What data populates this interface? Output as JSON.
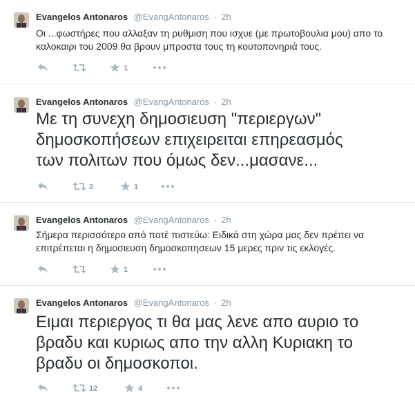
{
  "tweets": [
    {
      "name": "Evangelos Antonaros",
      "handle": "@EvangAntonaros",
      "separator": "·",
      "time": "2h",
      "text": "Οι ...φωστήρες που αλλαξαν τη ρυθμιση που ισχυε (με πρωτοβουλια μου) απο το καλοκαιρι του 2009 θα βρουν μπροστα τους τη κουτοπονηριά τους.",
      "retweets": "",
      "favorites": "1"
    },
    {
      "name": "Evangelos Antonaros",
      "handle": "@EvangAntonaros",
      "separator": "·",
      "time": "2h",
      "text": "Με τη συνεχη δημοσιευση \"περιεργων\" δημοσκοπήσεων επιχειρειται επηρεασμός των πολιτων που όμως δεν...μασανε...",
      "retweets": "2",
      "favorites": "1"
    },
    {
      "name": "Evangelos Antonaros",
      "handle": "@EvangAntonaros",
      "separator": "·",
      "time": "2h",
      "text": "Σήμερα περισσότερο από ποτέ πιστεύω: Ειδικά στη χώρα μας δεν πρέπει να επιτρέπεται η δημοσιευση δημοσκοπησεων 15 μερες πριν τις εκλογές.",
      "retweets": "",
      "favorites": "1"
    },
    {
      "name": "Evangelos Antonaros",
      "handle": "@EvangAntonaros",
      "separator": "·",
      "time": "2h",
      "text": "Ειμαι περιεργος τι θα μας λενε απο αυριο το βραδυ και κυριως απο την αλλη Κυριακη το βραδυ οι δημοσκοποι.",
      "retweets": "12",
      "favorites": "4"
    }
  ],
  "colors": {
    "name": "#292f33",
    "meta": "#8899a6",
    "divider": "#e1e8ed",
    "icon": "#aab8c2"
  },
  "icons": [
    "reply-icon",
    "retweet-icon",
    "favorite-star-icon",
    "more-dots-icon"
  ]
}
